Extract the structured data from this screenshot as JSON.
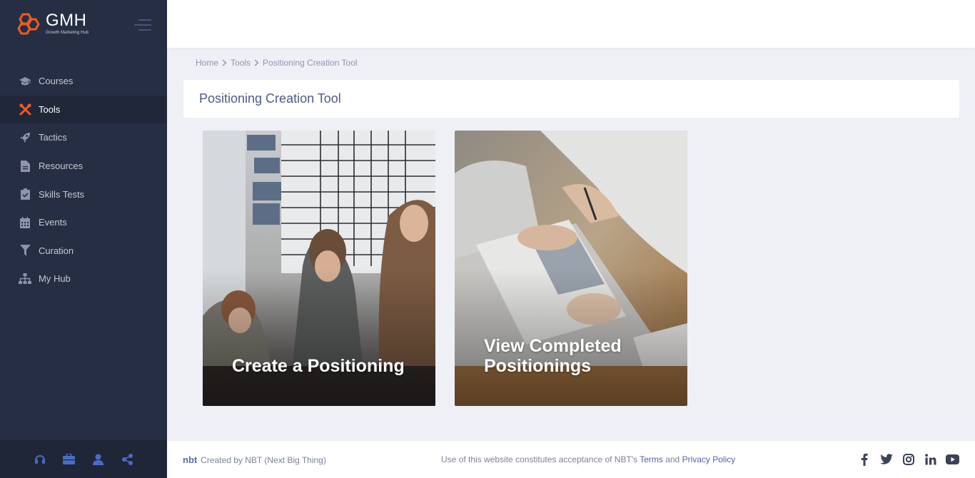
{
  "brand": {
    "title": "GMH",
    "subtitle": "Growth Marketing Hub",
    "accent": "#f05a22"
  },
  "sidebar": {
    "items": [
      {
        "label": "Courses",
        "icon": "graduation-cap-icon",
        "active": false
      },
      {
        "label": "Tools",
        "icon": "tools-icon",
        "active": true
      },
      {
        "label": "Tactics",
        "icon": "rocket-icon",
        "active": false
      },
      {
        "label": "Resources",
        "icon": "document-icon",
        "active": false
      },
      {
        "label": "Skills Tests",
        "icon": "clipboard-check-icon",
        "active": false
      },
      {
        "label": "Events",
        "icon": "calendar-icon",
        "active": false
      },
      {
        "label": "Curation",
        "icon": "filter-icon",
        "active": false
      },
      {
        "label": "My Hub",
        "icon": "sitemap-icon",
        "active": false
      }
    ],
    "footer_icons": [
      "headset-icon",
      "briefcase-icon",
      "user-icon",
      "share-icon"
    ]
  },
  "breadcrumb": {
    "home": "Home",
    "tools": "Tools",
    "current": "Positioning Creation Tool"
  },
  "page": {
    "title": "Positioning Creation Tool"
  },
  "cards": {
    "create": "Create a Positioning",
    "view": "View Completed Positionings"
  },
  "footer": {
    "nbt_logo": "nbt",
    "created_by": "Created by  NBT (Next Big Thing)",
    "notice": "Use of this website constitutes acceptance of NBT's ",
    "terms": "Terms",
    "and": " and ",
    "privacy": "Privacy Policy",
    "social": [
      "facebook-icon",
      "twitter-icon",
      "instagram-icon",
      "linkedin-icon",
      "youtube-icon"
    ]
  }
}
